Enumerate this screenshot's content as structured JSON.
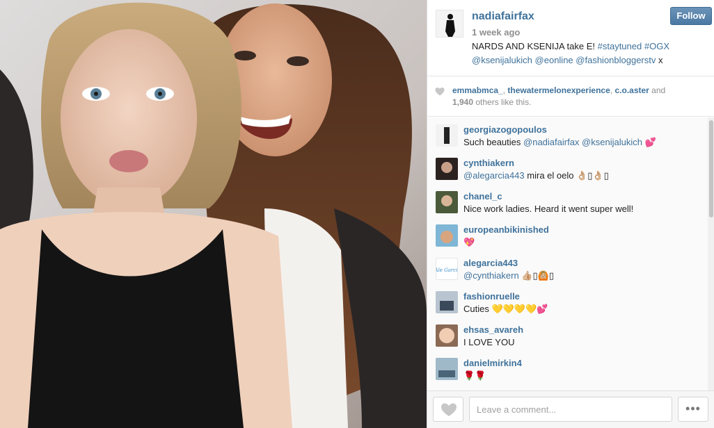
{
  "post": {
    "owner": "nadiafairfax",
    "time_ago": "1 week ago",
    "follow_label": "Follow",
    "caption": {
      "text_start": "NARDS AND KSENIJA take E! ",
      "hashtag1": "#staytuned",
      "hashtag2": "#OGX",
      "mention1": "@ksenijalukich",
      "mention2": "@eonline",
      "mention3": "@fashionbloggerstv",
      "text_end": " x"
    }
  },
  "likes": {
    "user1": "emmabmca_",
    "user2": "thewatermelonexperience",
    "user3": "c.o.aster",
    "and": " and",
    "count": "1,940",
    "suffix": " others like this."
  },
  "comments": [
    {
      "user": "georgiazogopoulos",
      "mention1": "@nadiafairfax",
      "mention2": "@ksenijalukich",
      "text_prefix": "Such beauties ",
      "text": " 💕"
    },
    {
      "user": "cynthiakern",
      "mention1": "@alegarcia443",
      "text": " mira el oelo 👌🏼▯👌🏼▯"
    },
    {
      "user": "chanel_c",
      "text": "Nice work ladies. Heard it went super well!"
    },
    {
      "user": "europeanbikinished",
      "text": "💖"
    },
    {
      "user": "alegarcia443",
      "mention1": "@cynthiakern",
      "text": " 👍🏼▯🙆🏼▯",
      "avatar_text": "Ale García"
    },
    {
      "user": "fashionruelle",
      "text": "Cuties 💛💛💛💛💕"
    },
    {
      "user": "ehsas_avareh",
      "text": "I LOVE YOU"
    },
    {
      "user": "danielmirkin4",
      "text": "🌹🌹"
    }
  ],
  "footer": {
    "placeholder": "Leave a comment...",
    "more_label": "•••"
  },
  "colors": {
    "link": "#3f729b",
    "follow_bg": "#4a78a3",
    "muted": "#8e8e8e"
  }
}
